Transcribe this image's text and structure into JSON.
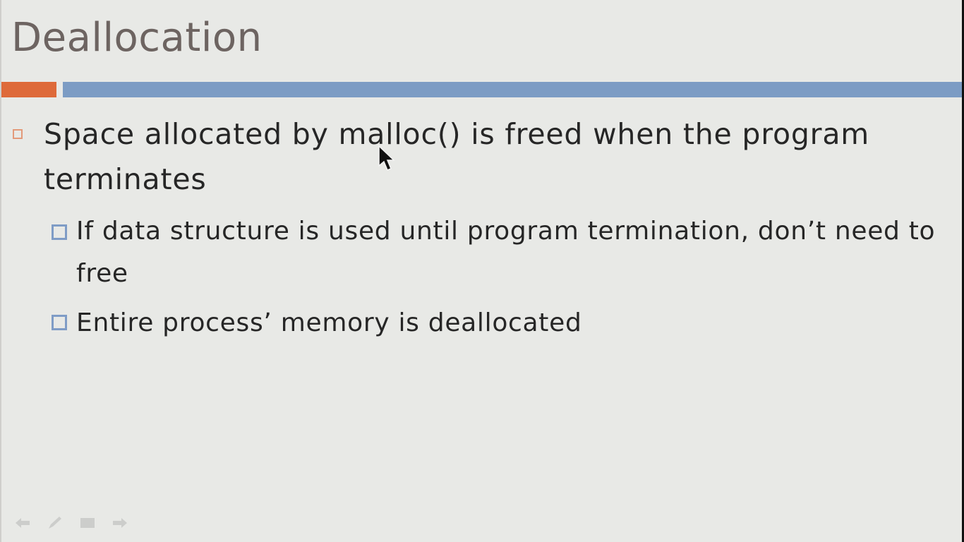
{
  "slide": {
    "title": "Deallocation",
    "bullets": [
      {
        "text": "Space allocated by malloc() is freed when the program terminates",
        "sub_bullets": [
          "If data structure is used until program termination, don’t need to free",
          "Entire process’ memory is deallocated"
        ]
      }
    ]
  },
  "colors": {
    "background": "#e8e9e6",
    "title": "#6d6461",
    "accent_orange": "#de6a3a",
    "accent_blue": "#7c9cc4"
  },
  "nav_icons": [
    "back-arrow-icon",
    "pen-icon",
    "menu-icon",
    "forward-arrow-icon"
  ]
}
